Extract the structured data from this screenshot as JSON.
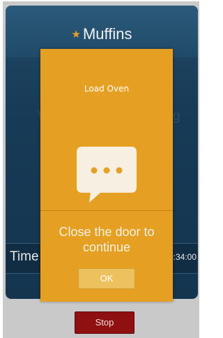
{
  "app": {
    "title": "Muffins",
    "title_icon": "star-icon",
    "background_status_left": "W",
    "background_status_right": "g"
  },
  "details": {
    "time_label": "Time",
    "time_value": "0:34:00"
  },
  "actions": {
    "stop_label": "Stop"
  },
  "dialog": {
    "title": "Load Oven",
    "icon": "chat-bubble-icon",
    "message_line1": "Close the door to",
    "message_line2": "continue",
    "ok_label": "OK"
  },
  "colors": {
    "dialog_background": "#e5a023",
    "app_background": "#1f4865",
    "stop_button": "#8e1010",
    "accent_star": "#e3a226"
  }
}
